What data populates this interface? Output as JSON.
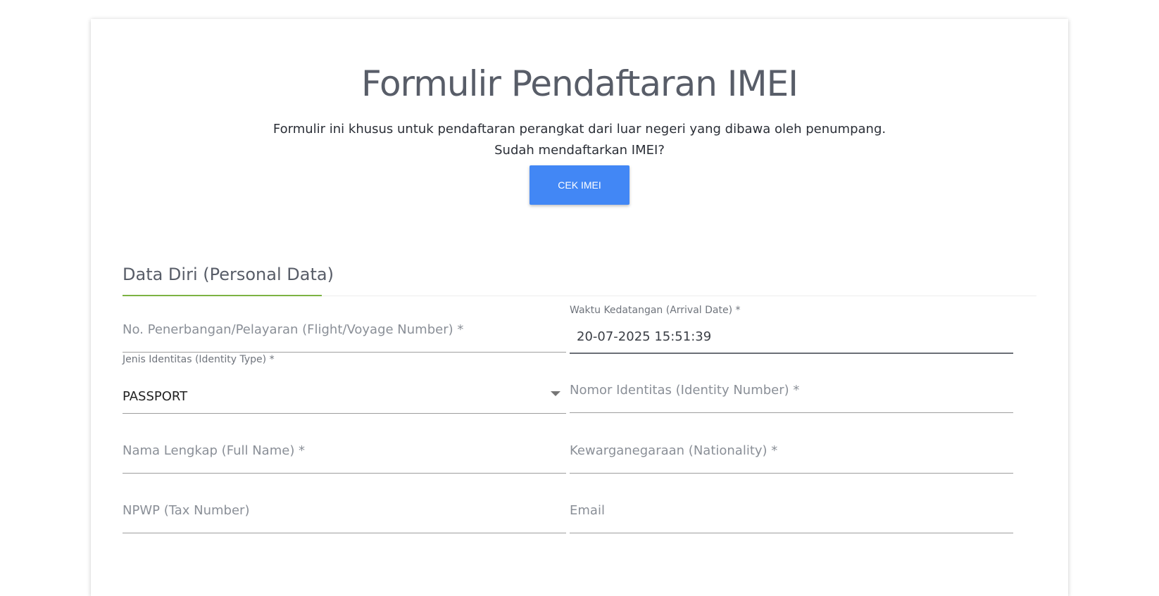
{
  "header": {
    "title": "Formulir Pendaftaran IMEI",
    "description": "Formulir ini khusus untuk pendaftaran perangkat dari luar negeri yang dibawa oleh penumpang.",
    "question": "Sudah mendaftarkan IMEI?",
    "cek_button": "CEK IMEI"
  },
  "section": {
    "title": "Data Diri (Personal Data)"
  },
  "form": {
    "flight_number": {
      "placeholder": "No. Penerbangan/Pelayaran (Flight/Voyage Number) *"
    },
    "arrival_date": {
      "label": "Waktu Kedatangan (Arrival Date) *",
      "value": "20-07-2025  15:51:39"
    },
    "identity_type": {
      "label": "Jenis Identitas (Identity Type) *",
      "value": "PASSPORT"
    },
    "identity_number": {
      "placeholder": "Nomor Identitas (Identity Number) *"
    },
    "full_name": {
      "placeholder": "Nama Lengkap (Full Name) *"
    },
    "nationality": {
      "placeholder": "Kewarganegaraan (Nationality) *"
    },
    "npwp": {
      "placeholder": "NPWP (Tax Number)"
    },
    "email": {
      "placeholder": "Email"
    }
  },
  "colors": {
    "button": "#4287f5",
    "tab_underline": "#7cb342",
    "title": "#585d68"
  }
}
